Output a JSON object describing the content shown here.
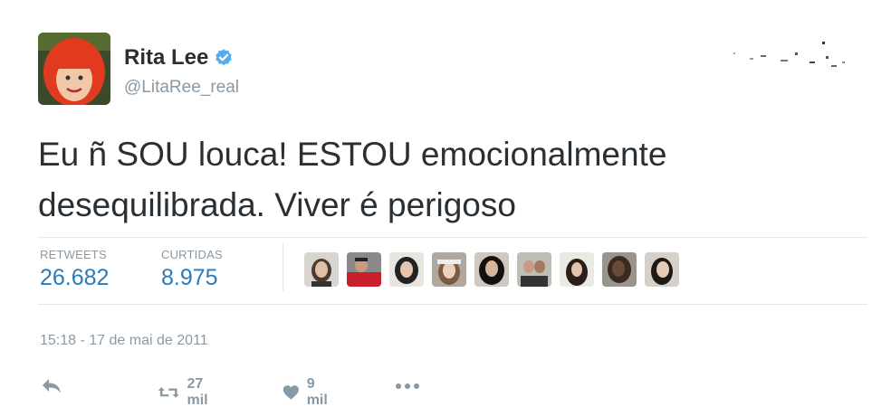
{
  "tweet": {
    "author": {
      "name": "Rita Lee",
      "handle": "@LitaRee_real",
      "verified": true,
      "verified_color": "#55acee",
      "avatar_icon": "red-haired-portrait-avatar"
    },
    "text_line1": "Eu ñ SOU louca! ESTOU emocionalmente",
    "text_line2": "desequilibrada. Viver é perigoso",
    "stats": {
      "retweets_label": "RETWEETS",
      "retweets_value": "26.682",
      "likes_label": "CURTIDAS",
      "likes_value": "8.975"
    },
    "timestamp": "15:18 - 17 de mai de 2011",
    "actions": {
      "reply_icon": "reply-icon",
      "retweet_count": "27 mil",
      "like_count": "9 mil",
      "more_icon": "more-icon"
    },
    "colors": {
      "text": "#292f33",
      "muted": "#8899a6",
      "stat_value": "#2b7bb9",
      "divider": "#e1e8ed"
    }
  }
}
